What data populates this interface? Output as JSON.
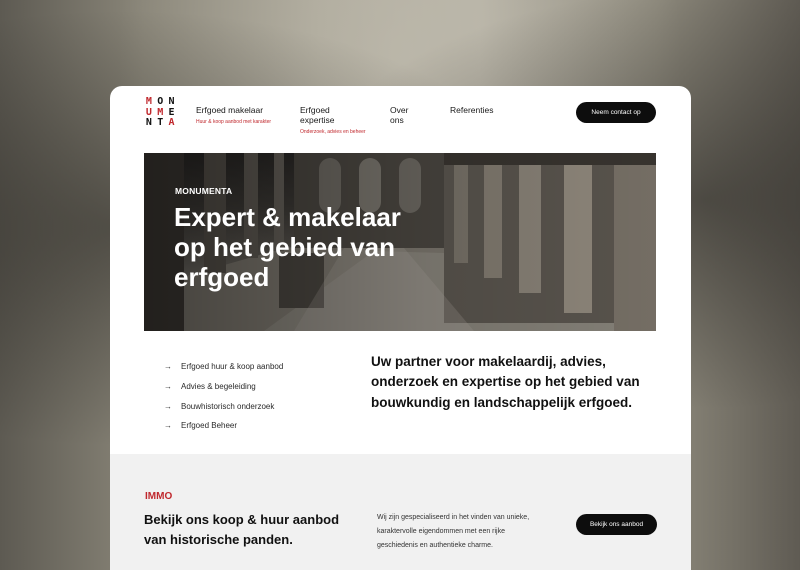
{
  "brand": {
    "logo_rows": [
      [
        "M",
        "O",
        "N"
      ],
      [
        "U",
        "M",
        "E"
      ],
      [
        "N",
        "T",
        "A"
      ]
    ],
    "logo_colors": [
      "#c0282d",
      "#111111",
      "#111111",
      "#c0282d",
      "#c0282d",
      "#111111",
      "#111111",
      "#111111",
      "#c0282d"
    ]
  },
  "nav": {
    "items": [
      {
        "label": "Erfgoed makelaar",
        "sub": "Huur & koop aanbod met karakter"
      },
      {
        "label": "Erfgoed expertise",
        "sub": "Onderzoek, advies en beheer"
      },
      {
        "label": "Over ons",
        "sub": ""
      },
      {
        "label": "Referenties",
        "sub": ""
      }
    ],
    "cta_label": "Neem contact op"
  },
  "hero": {
    "kicker": "MONUMENTA",
    "title": "Expert & makelaar op het gebied van erfgoed"
  },
  "services": {
    "arrow_icon": "→",
    "items": [
      "Erfgoed huur & koop aanbod",
      "Advies & begeleiding",
      "Bouwhistorisch onderzoek",
      "Erfgoed Beheer"
    ]
  },
  "tagline": "Uw partner voor makelaardij, advies, onderzoek en expertise op het gebied van bouwkundig en landschappelijk erfgoed.",
  "immo": {
    "kicker": "IMMO",
    "title": "Bekijk ons koop & huur aanbod van historische  panden.",
    "text": "Wij zijn gespecialiseerd in het vinden van unieke, karaktervolle eigendommen met een rijke geschiedenis en authentieke charme.",
    "button_label": "Bekijk ons aanbod"
  },
  "colors": {
    "accent": "#c0282d",
    "button_bg": "#0d0d0d",
    "section_bg": "#f1f1f1"
  }
}
